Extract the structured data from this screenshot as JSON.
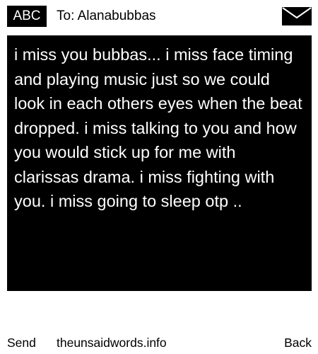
{
  "header": {
    "badge": "ABC",
    "to_line": "To: Alanabubbas",
    "envelope_icon": "envelope-icon"
  },
  "message": {
    "text": "i miss you bubbas... i miss face timing and playing music just so we could look in each others eyes when the beat dropped. i miss talking to you and how you would stick up for me with clarissas drama. i miss fighting with you. i miss going to sleep otp .."
  },
  "footer": {
    "send_label": "Send",
    "site_label": "theunsaidwords.info",
    "back_label": "Back"
  },
  "colors": {
    "background": "#ffffff",
    "message_bg": "#000000",
    "message_text": "#ffffff"
  }
}
